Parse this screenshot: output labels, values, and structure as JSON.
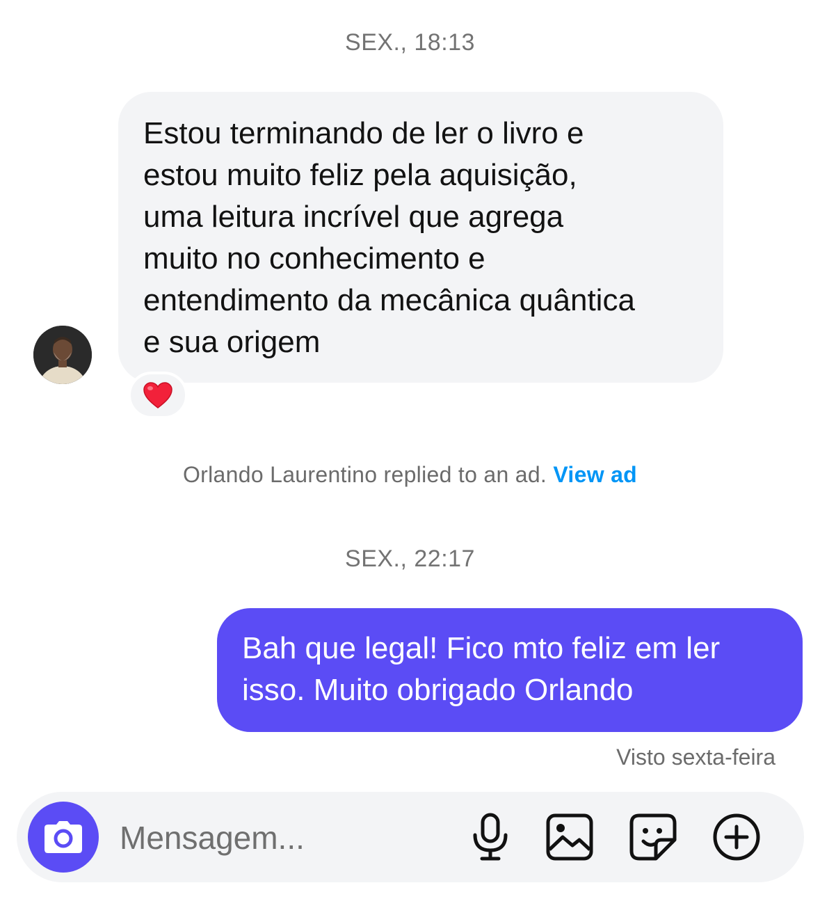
{
  "timestamps": {
    "first": "SEX., 18:13",
    "second": "SEX., 22:17"
  },
  "incoming_message": {
    "lines": [
      "Estou terminando de ler o livro e",
      "estou muito feliz pela aquisição,",
      "uma leitura incrível que agrega",
      "muito no conhecimento e",
      "entendimento da mecânica quântica",
      "e sua origem"
    ],
    "reaction": "❤️",
    "bubble_color": "#f3f4f6"
  },
  "ad_notice": {
    "text": "Orlando Laurentino replied to an ad.",
    "link_label": "View ad",
    "link_color": "#0095f6"
  },
  "outgoing_message": {
    "lines": [
      "Bah que legal! Fico mto feliz em ler",
      "isso. Muito obrigado Orlando"
    ],
    "bubble_color": "#5b4cf5",
    "status": "Visto sexta-feira"
  },
  "composer": {
    "placeholder": "Mensagem...",
    "icons": [
      "camera-icon",
      "microphone-icon",
      "gallery-icon",
      "sticker-icon",
      "plus-icon"
    ],
    "accent": "#5b4cf5"
  }
}
